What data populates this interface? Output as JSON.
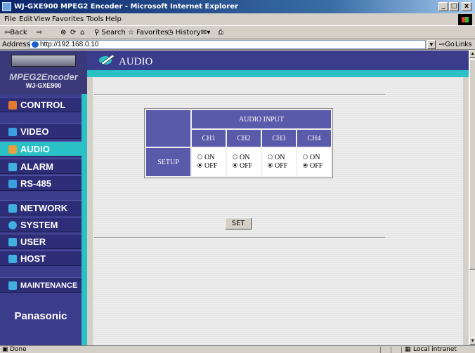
{
  "window": {
    "title": "WJ-GXE900 MPEG2 Encoder - Microsoft Internet Explorer",
    "minimize": "_",
    "maximize": "□",
    "close": "x"
  },
  "menu": [
    "File",
    "Edit",
    "View",
    "Favorites",
    "Tools",
    "Help"
  ],
  "toolbar": {
    "back": "⇦Back",
    "forward": "⇨",
    "search": "Search",
    "favorites": "Favorites",
    "history": "History"
  },
  "address": {
    "label": "Address",
    "url": "http://192.168.0.10",
    "go": "Go",
    "links": "Links »"
  },
  "sidebar": {
    "logo_main": "MPEG2Encoder",
    "logo_model": "WJ-GXE900",
    "items": [
      {
        "label": "CONTROL",
        "icon": "control-icon",
        "color": "#e87830"
      },
      {
        "label": "VIDEO",
        "icon": "video-icon",
        "color": "#3aa0e0"
      },
      {
        "label": "AUDIO",
        "icon": "audio-icon",
        "color": "#e8a040"
      },
      {
        "label": "ALARM",
        "icon": "alarm-icon",
        "color": "#40b0e0"
      },
      {
        "label": "RS-485",
        "icon": "rs485-icon",
        "color": "#3aa0e0"
      },
      {
        "label": "NETWORK",
        "icon": "network-icon",
        "color": "#40b0e0"
      },
      {
        "label": "SYSTEM",
        "icon": "system-icon",
        "color": "#40b0e0"
      },
      {
        "label": "USER",
        "icon": "user-icon",
        "color": "#40b0e0"
      },
      {
        "label": "HOST",
        "icon": "host-icon",
        "color": "#40b0e0"
      },
      {
        "label": "MAINTENANCE",
        "icon": "maintenance-icon",
        "color": "#40b0e0"
      }
    ],
    "active": "AUDIO",
    "brand": "Panasonic"
  },
  "page": {
    "title": "AUDIO"
  },
  "audio_table": {
    "group_header": "AUDIO INPUT",
    "row_label": "SETUP",
    "channels": [
      {
        "name": "CH1",
        "on_label": "ON",
        "off_label": "OFF",
        "selected": "OFF"
      },
      {
        "name": "CH2",
        "on_label": "ON",
        "off_label": "OFF",
        "selected": "OFF"
      },
      {
        "name": "CH3",
        "on_label": "ON",
        "off_label": "OFF",
        "selected": "OFF"
      },
      {
        "name": "CH4",
        "on_label": "ON",
        "off_label": "OFF",
        "selected": "OFF"
      }
    ]
  },
  "set_button": "SET",
  "status": {
    "text": "Done",
    "zone": "Local intranet"
  },
  "colors": {
    "sidebar_bg": "#3c3c8c",
    "accent_cyan": "#29c1c6",
    "table_header": "#5a5aaa"
  }
}
